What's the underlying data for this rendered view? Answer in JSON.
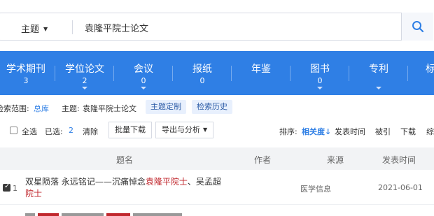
{
  "search": {
    "scope_label": "主题",
    "query": "袁隆平院士论文"
  },
  "tabs": [
    {
      "label": "学术期刊",
      "count": "3"
    },
    {
      "label": "学位论文",
      "count": "2"
    },
    {
      "label": "会议",
      "count": "0"
    },
    {
      "label": "报纸",
      "count": "0"
    },
    {
      "label": "年鉴",
      "count": ""
    },
    {
      "label": "图书",
      "count": "0"
    },
    {
      "label": "专利",
      "count": ""
    },
    {
      "label": "标",
      "count": ""
    }
  ],
  "scope_row": {
    "range_label": "检索范围:",
    "range_value": "总库",
    "topic_label": "主题:",
    "topic_value": "袁隆平院士论文",
    "customize_button": "主题定制",
    "history_button": "检索历史"
  },
  "toolbar": {
    "select_all": "全选",
    "selected_label": "已选:",
    "selected_count": "2",
    "clear": "清除",
    "batch_download": "批量下载",
    "export": "导出与分析",
    "sort_label": "排序:",
    "sort_relevance": "相关度",
    "sort_date": "发表时间",
    "sort_cited": "被引",
    "sort_download": "下载",
    "sort_more": "综"
  },
  "table": {
    "headers": {
      "title": "题名",
      "author": "作者",
      "source": "来源",
      "date": "发表时间"
    },
    "rows": [
      {
        "index": "1",
        "title_part1": "双星陨落 永远铭记——沉痛悼念",
        "title_hl1": "袁隆平院士",
        "title_part2": "、吴孟超",
        "title_hl2": "院士",
        "source": "医学信息",
        "date": "2021-06-01"
      }
    ]
  }
}
